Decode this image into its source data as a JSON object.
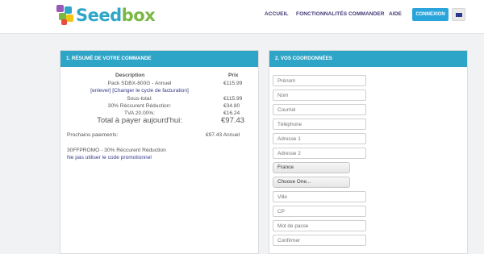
{
  "brand": {
    "name_part1": "Seed",
    "name_part2": "box"
  },
  "nav": {
    "accueil": "ACCUEIL",
    "fonctionnalites": "FONCTIONNALITÉS",
    "commander": "COMMANDER",
    "aide": "AIDE",
    "connexion": "CONNEXION"
  },
  "summary": {
    "title": "1. RÉSUMÉ DE VOTRE COMMANDE",
    "col_description": "Description",
    "col_prix": "Prix",
    "rows": [
      {
        "label": "Pack SDBX-800G - Annuel",
        "value": "€115.99"
      },
      {
        "label": "Sous-total:",
        "value": "€115.99"
      },
      {
        "label": "30% Réccurent Réduction:",
        "value": "€34.80"
      },
      {
        "label": "TVA 20.00%:",
        "value": "€16.24"
      }
    ],
    "links": "[enlever] [Changer le cycle de facturation]",
    "total_label": "Total à payer aujourd'hui:",
    "total_value": "€97.43",
    "next_label": "Prochains paiements:",
    "next_value": "€97.43 Annuel",
    "promo_text": "30FFPROMO - 30% Réccurent Réduction",
    "promo_link": "Ne pas utiliser le code promotionnel"
  },
  "coords": {
    "title": "2. VOS COORDONNÉES",
    "fields": {
      "prenom": "Prénom",
      "nom": "Nom",
      "courriel": "Courriel",
      "telephone": "Téléphone",
      "adresse1": "Adresse 1",
      "adresse2": "Adresse 2",
      "ville": "Ville",
      "cp": "CP",
      "motdepasse": "Mot de passe",
      "confirmer": "Confirmer"
    },
    "country": "France",
    "region": "Choose One..."
  },
  "colors": {
    "accent": "#2ea4c7",
    "button": "#2aa5db",
    "nav_text": "#3f3875",
    "link": "#333a8a"
  }
}
